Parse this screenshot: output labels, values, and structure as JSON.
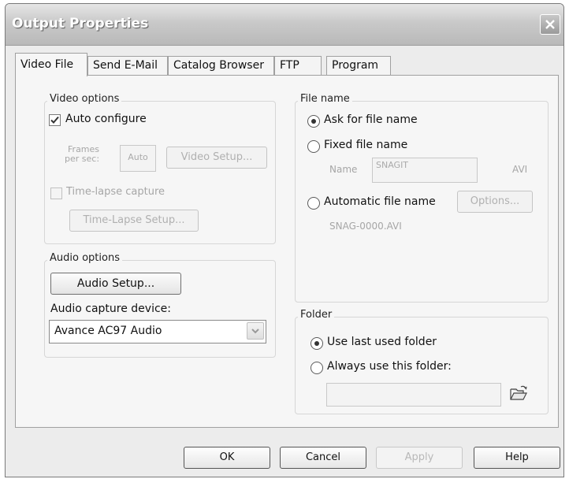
{
  "window": {
    "title": "Output Properties"
  },
  "tabs": [
    {
      "label": "Video File",
      "active": true
    },
    {
      "label": "Send E-Mail"
    },
    {
      "label": "Catalog Browser"
    },
    {
      "label": "FTP"
    },
    {
      "label": "Program"
    }
  ],
  "video_options": {
    "group_label": "Video options",
    "auto_configure": {
      "label": "Auto configure",
      "checked": true
    },
    "frames_per_sec": {
      "label_line1": "Frames",
      "label_line2": "per sec:",
      "value": "Auto"
    },
    "video_setup_button": "Video Setup...",
    "time_lapse_capture": {
      "label": "Time-lapse capture",
      "checked": false
    },
    "time_lapse_setup_button": "Time-Lapse Setup..."
  },
  "audio_options": {
    "group_label": "Audio options",
    "audio_setup_button": "Audio Setup...",
    "capture_device_label": "Audio capture device:",
    "capture_device_value": "Avance AC97 Audio"
  },
  "file_name": {
    "group_label": "File name",
    "ask_for_file_name": {
      "label": "Ask for file name",
      "selected": true
    },
    "fixed_file_name": {
      "label": "Fixed file name",
      "selected": false
    },
    "name_label": "Name",
    "name_value": "SNAGIT",
    "name_ext": "AVI",
    "automatic_file_name": {
      "label": "Automatic file name",
      "selected": false
    },
    "options_button": "Options...",
    "automatic_example": "SNAG-0000.AVI"
  },
  "folder": {
    "group_label": "Folder",
    "use_last_used_folder": {
      "label": "Use last used folder",
      "selected": true
    },
    "always_use_this_folder": {
      "label": "Always use this folder:",
      "selected": false
    },
    "folder_path": ""
  },
  "buttons": {
    "ok": "OK",
    "cancel": "Cancel",
    "apply": "Apply",
    "help": "Help"
  }
}
